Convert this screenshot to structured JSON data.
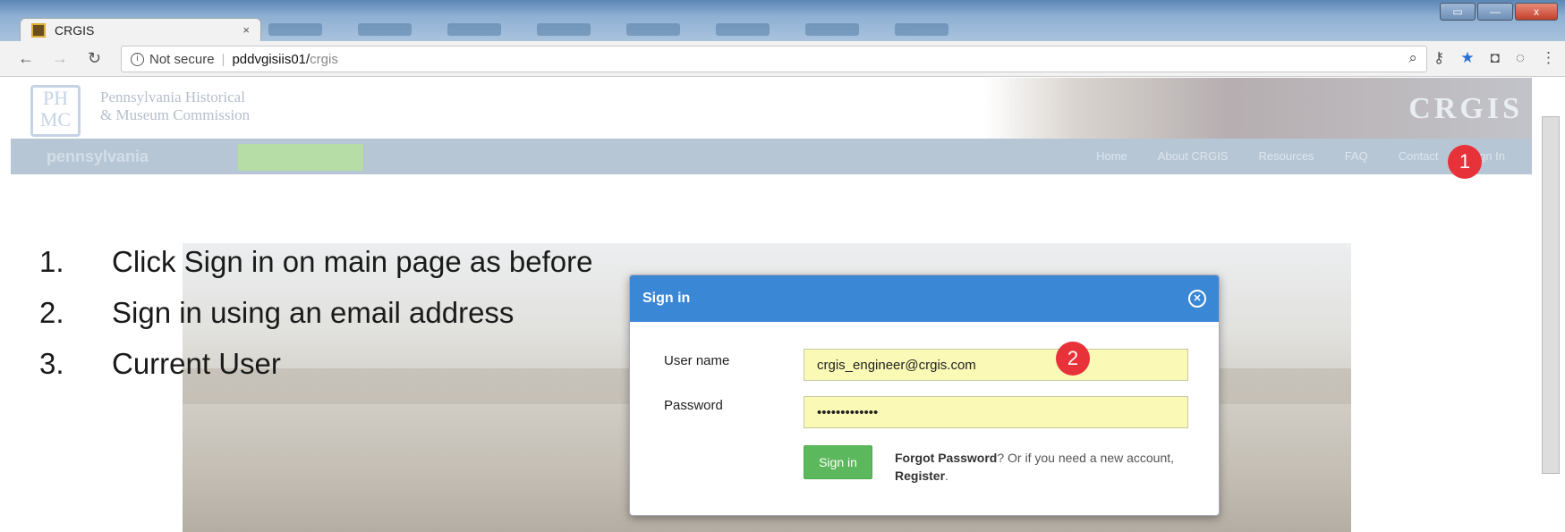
{
  "browser": {
    "tab_title": "CRGIS",
    "tab_close": "×",
    "security_label": "Not secure",
    "url_host": "pddvgisiis01/",
    "url_path": "crgis",
    "window_controls": [
      "▭",
      "—",
      "x"
    ]
  },
  "site": {
    "org_name_line1": "Pennsylvania Historical",
    "org_name_line2": "& Museum Commission",
    "logo_text": "PH MC",
    "app_logo": "CRGIS",
    "state_logo": "pennsylvania",
    "nav_items": [
      "Home",
      "About CRGIS",
      "Resources",
      "FAQ",
      "Contact",
      "Sign In"
    ]
  },
  "steps": [
    {
      "num": "1.",
      "text": "Click Sign in on main page as before"
    },
    {
      "num": "2.",
      "text": "Sign in using an email address"
    },
    {
      "num": "3.",
      "text": "Current User"
    }
  ],
  "modal": {
    "title": "Sign in",
    "username_label": "User name",
    "username_value": "crgis_engineer@crgis.com",
    "password_label": "Password",
    "password_value": "•••••••••••••",
    "submit_label": "Sign in",
    "forgot_label": "Forgot Password",
    "forgot_middle": "? Or if you need a new account,",
    "register_label": "Register",
    "forgot_end": "."
  },
  "badges": [
    "1",
    "2"
  ]
}
